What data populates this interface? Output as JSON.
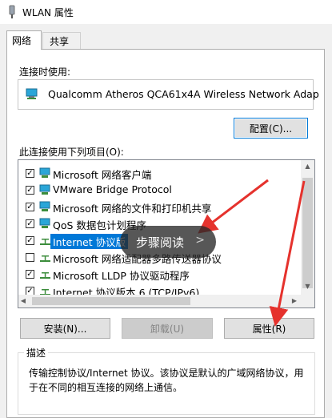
{
  "window": {
    "title": "WLAN 属性"
  },
  "tabs": [
    {
      "label": "网络",
      "active": true
    },
    {
      "label": "共享",
      "active": false
    }
  ],
  "connection": {
    "label": "连接时使用:",
    "adapter": "Qualcomm Atheros QCA61x4A Wireless Network Adap",
    "configure_button": "配置(C)..."
  },
  "items": {
    "label": "此连接使用下列项目(O):",
    "list": [
      {
        "label": "Microsoft 网络客户端",
        "checked": true,
        "icon": "network-client-icon"
      },
      {
        "label": "VMware Bridge Protocol",
        "checked": true,
        "icon": "network-protocol-icon"
      },
      {
        "label": "Microsoft 网络的文件和打印机共享",
        "checked": true,
        "icon": "network-service-icon"
      },
      {
        "label": "QoS 数据包计划程序",
        "checked": true,
        "icon": "network-service-icon"
      },
      {
        "label": "Internet 协议版",
        "checked": true,
        "icon": "network-protocol-icon",
        "selected": true
      },
      {
        "label": "Microsoft 网络适配器多路传送器协议",
        "checked": false,
        "icon": "network-protocol-icon"
      },
      {
        "label": "Microsoft LLDP 协议驱动程序",
        "checked": true,
        "icon": "network-protocol-icon"
      },
      {
        "label": "Internet 协议版本 6 (TCP/IPv6)",
        "checked": true,
        "icon": "network-protocol-icon"
      }
    ]
  },
  "buttons": {
    "install": "安装(N)...",
    "uninstall": "卸载(U)",
    "properties": "属性(R)"
  },
  "description": {
    "label": "描述",
    "text": "传输控制协议/Internet 协议。该协议是默认的广域网络协议，用于在不同的相互连接的网络上通信。"
  },
  "overlay": {
    "label": "步骤阅读"
  },
  "colors": {
    "accent": "#0078d7",
    "annotation_arrow": "#e5322d"
  }
}
